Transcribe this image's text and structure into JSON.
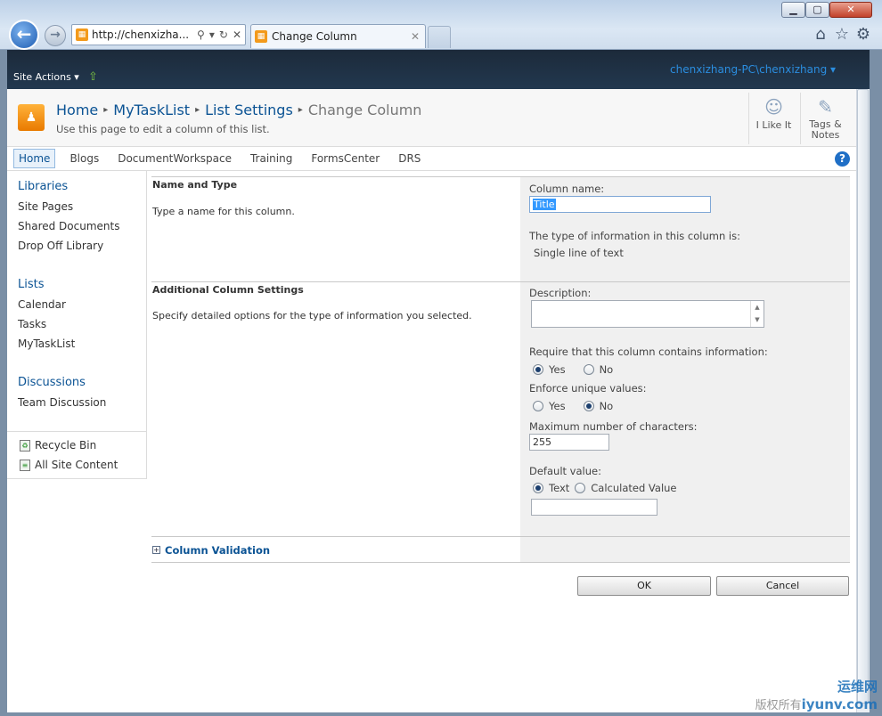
{
  "browser": {
    "address": "http://chenxizha...",
    "tab_title": "Change Column",
    "window_controls": {
      "minimize": "▁",
      "maximize": "▢",
      "close": "✕"
    }
  },
  "ribbon": {
    "site_actions": "Site Actions ▾",
    "user": "chenxizhang-PC\\chenxizhang ▾"
  },
  "title_area": {
    "breadcrumb": [
      "Home",
      "MyTaskList",
      "List Settings",
      "Change Column"
    ],
    "description": "Use this page to edit a column of this list.",
    "i_like_it": "I Like It",
    "tags_notes": [
      "Tags &",
      "Notes"
    ]
  },
  "topnav": {
    "items": [
      "Home",
      "Blogs",
      "DocumentWorkspace",
      "Training",
      "FormsCenter",
      "DRS"
    ],
    "selected": "Home"
  },
  "quicklaunch": {
    "libraries": {
      "heading": "Libraries",
      "items": [
        "Site Pages",
        "Shared Documents",
        "Drop Off Library"
      ]
    },
    "lists": {
      "heading": "Lists",
      "items": [
        "Calendar",
        "Tasks",
        "MyTaskList"
      ]
    },
    "discussions": {
      "heading": "Discussions",
      "items": [
        "Team Discussion"
      ]
    },
    "recycle_bin": "Recycle Bin",
    "all_site_content": "All Site Content"
  },
  "form": {
    "name_type": {
      "title": "Name and Type",
      "desc": "Type a name for this column.",
      "column_name_label": "Column name:",
      "column_name_value": "Title",
      "type_label": "The type of information in this column is:",
      "type_value": "Single line of text"
    },
    "additional": {
      "title": "Additional Column Settings",
      "desc": "Specify detailed options for the type of information you selected.",
      "description_label": "Description:",
      "description_value": "",
      "require_label": "Require that this column contains information:",
      "require_value": "Yes",
      "unique_label": "Enforce unique values:",
      "unique_value": "No",
      "yes": "Yes",
      "no": "No",
      "max_chars_label": "Maximum number of characters:",
      "max_chars_value": "255",
      "default_label": "Default value:",
      "default_text": "Text",
      "default_calc": "Calculated Value",
      "default_selected": "Text",
      "default_value": ""
    },
    "validation_link": "Column Validation",
    "ok": "OK",
    "cancel": "Cancel"
  },
  "watermark": [
    "运维网",
    "iyunv.com"
  ],
  "watermark_prefix": "版权所有",
  "colors": {
    "link": "#0b5394",
    "ribbon": "#1c2a3a",
    "accent": "#2b8ee0"
  }
}
